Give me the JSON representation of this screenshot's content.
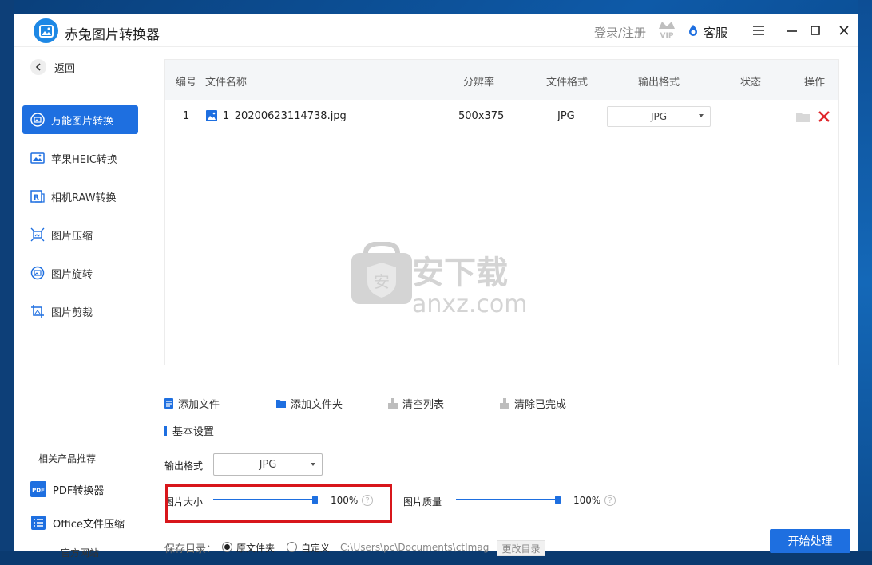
{
  "app": {
    "title": "赤兔图片转换器",
    "login_label": "登录/注册",
    "vip_label": "VIP",
    "service_label": "客服",
    "accent_color": "#1e6fe0",
    "highlight_color": "#d8161b"
  },
  "sidebar": {
    "back_label": "返回",
    "items": [
      {
        "label": "万能图片转换",
        "icon": "image-convert-icon",
        "active": true
      },
      {
        "label": "苹果HEIC转换",
        "icon": "heic-icon",
        "active": false
      },
      {
        "label": "相机RAW转换",
        "icon": "raw-icon",
        "active": false
      },
      {
        "label": "图片压缩",
        "icon": "compress-icon",
        "active": false
      },
      {
        "label": "图片旋转",
        "icon": "rotate-icon",
        "active": false
      },
      {
        "label": "图片剪裁",
        "icon": "crop-icon",
        "active": false
      }
    ],
    "recommend_title": "相关产品推荐",
    "pdf_icon_text": "PDF",
    "recommend": [
      {
        "label": "PDF转换器",
        "icon": "pdf-icon"
      },
      {
        "label": "Office文件压缩",
        "icon": "office-icon"
      }
    ],
    "site_label": "官方网站"
  },
  "table": {
    "headers": {
      "index": "编号",
      "name": "文件名称",
      "resolution": "分辨率",
      "format": "文件格式",
      "output": "输出格式",
      "status": "状态",
      "ops": "操作"
    },
    "rows": [
      {
        "index": "1",
        "name": "1_20200623114738.jpg",
        "resolution": "500x375",
        "format": "JPG",
        "output": "JPG",
        "status": ""
      }
    ]
  },
  "watermark": {
    "shield_char": "安",
    "brand": "安下载",
    "domain": "anxz.com"
  },
  "actions": {
    "add_file": "添加文件",
    "add_folder": "添加文件夹",
    "clear_list": "清空列表",
    "clear_done": "清除已完成"
  },
  "settings": {
    "section_title": "基本设置",
    "output_format_label": "输出格式",
    "output_format_value": "JPG",
    "size_label": "图片大小",
    "size_value": "100%",
    "size_fraction": 1.0,
    "quality_label": "图片质量",
    "quality_value": "100%",
    "quality_fraction": 1.0,
    "help_glyph": "?",
    "save_dir_label": "保存目录：",
    "radio_original": "原文件夹",
    "radio_custom": "自定义",
    "selected_radio": "original",
    "path": "C:\\Users\\pc\\Documents\\ctImag",
    "change_dir": "更改目录",
    "start_button": "开始处理"
  }
}
